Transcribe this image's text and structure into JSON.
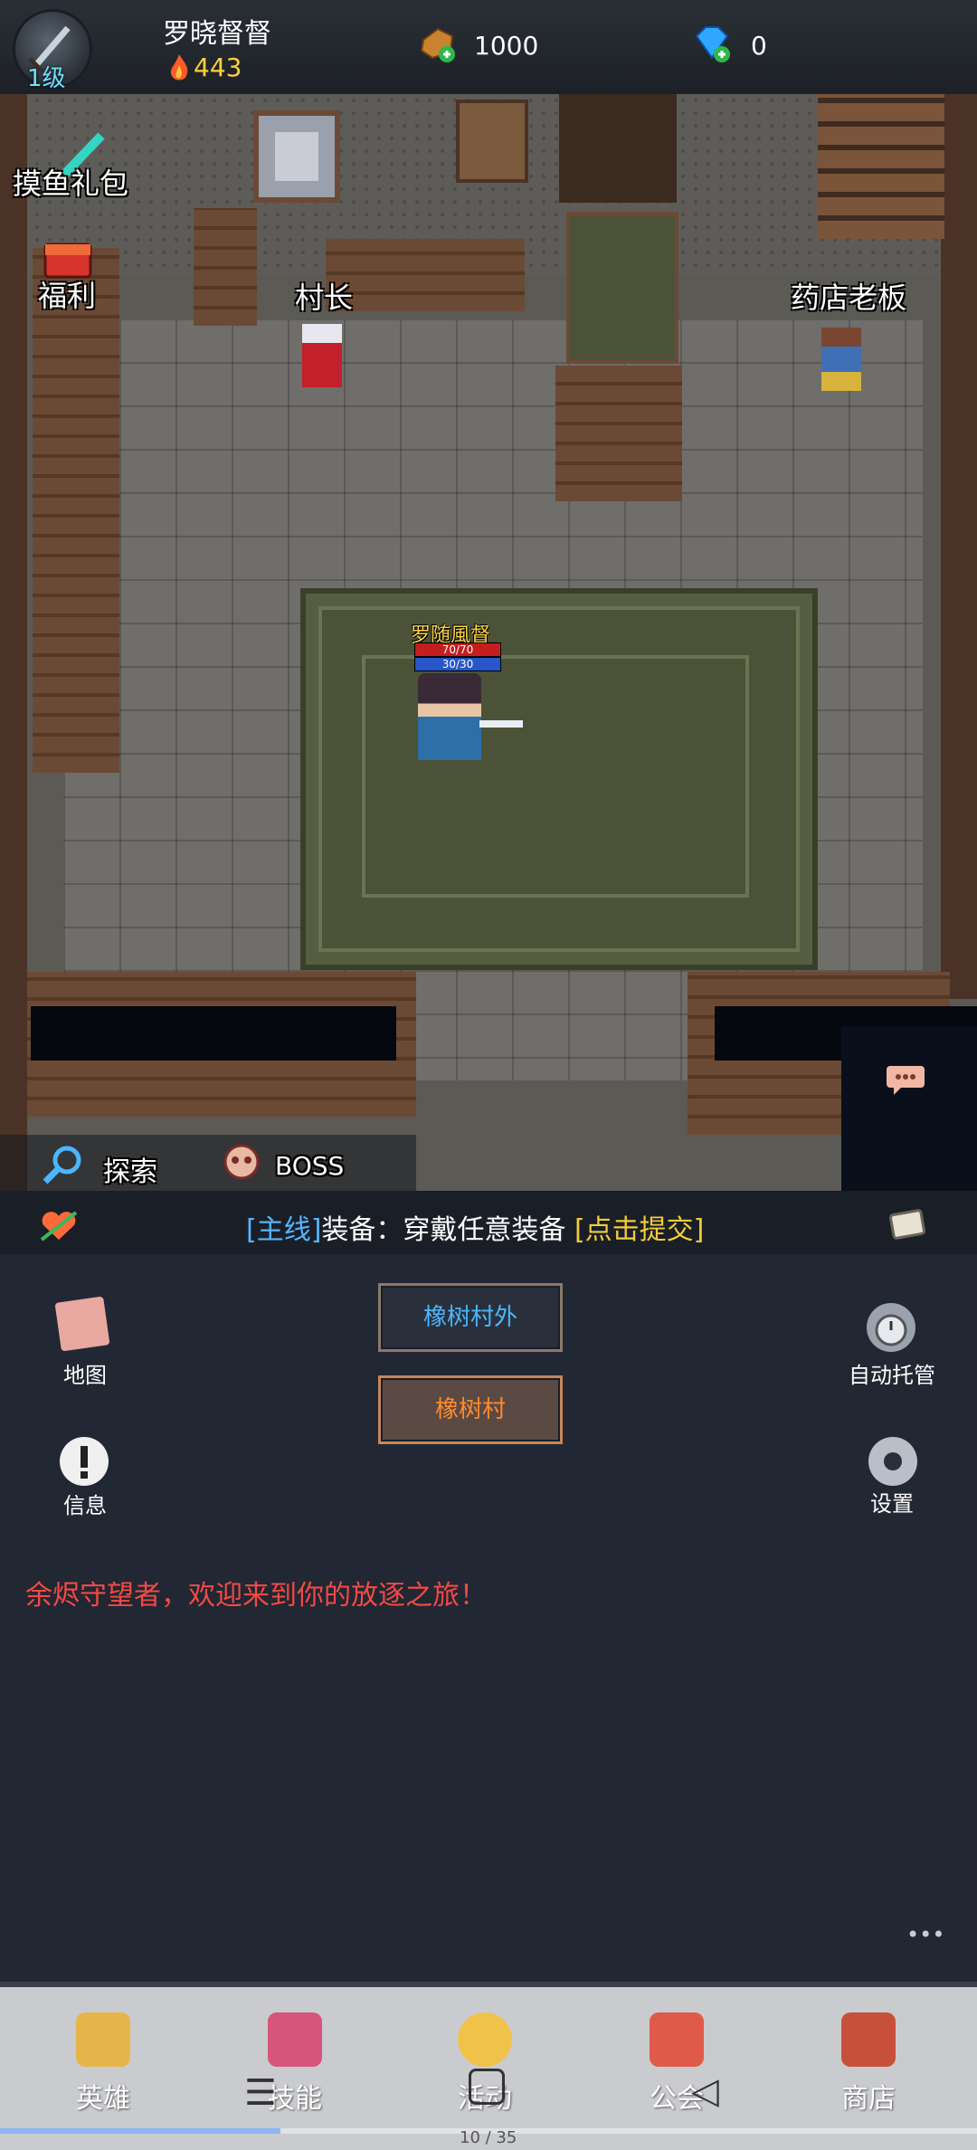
{
  "player": {
    "level": "1级",
    "name": "罗晓督督",
    "power": "443"
  },
  "currency": {
    "gold": "1000",
    "gems": "0"
  },
  "scene": {
    "gift_label": "摸鱼礼包",
    "welfare_label": "福利",
    "npc_chief": "村长",
    "npc_shop": "药店老板",
    "hero_name": "罗随風督",
    "hp": "70/70",
    "mp": "30/30",
    "hp_fraction": 1.0,
    "mp_fraction": 1.0,
    "explore_label": "探索",
    "boss_label": "BOSS"
  },
  "quest": {
    "tag": "[主线]",
    "body": "装备：穿戴任意装备",
    "action": "[点击提交]"
  },
  "panel": {
    "map_label": "地图",
    "info_label": "信息",
    "auto_label": "自动托管",
    "settings_label": "设置",
    "btn_outside": "橡树村外",
    "btn_village": "橡树村",
    "welcome": "余烬守望者，欢迎来到你的放逐之旅！",
    "more": "•••"
  },
  "nav": {
    "hero": "英雄",
    "skill": "技能",
    "activity": "活动",
    "guild": "公会",
    "shop": "商店"
  },
  "system": {
    "page_indicator": "10 / 35",
    "progress_fraction": 0.286
  },
  "colors": {
    "quest_tag": "#56b4ff",
    "quest_action": "#f2cc3c",
    "welcome": "#f24a44",
    "btn_outside_text": "#4ab6ff",
    "btn_village_text": "#ff8a2a",
    "power": "#ffcf3a",
    "level": "#6fe0ff"
  },
  "icons": {
    "avatar": "sword-icon",
    "power": "fire-icon",
    "gold": "gold-ore-icon",
    "gems": "diamond-icon",
    "gift": "sword-gift-icon",
    "welfare": "chest-icon",
    "explore": "magnifier-icon",
    "boss": "skull-icon",
    "chat": "chat-bubble-icon",
    "quest_left": "heart-arrow-icon",
    "quest_right": "scroll-icon",
    "map": "map-scroll-icon",
    "info": "exclamation-icon",
    "auto": "stopwatch-icon",
    "settings": "gear-icon"
  }
}
